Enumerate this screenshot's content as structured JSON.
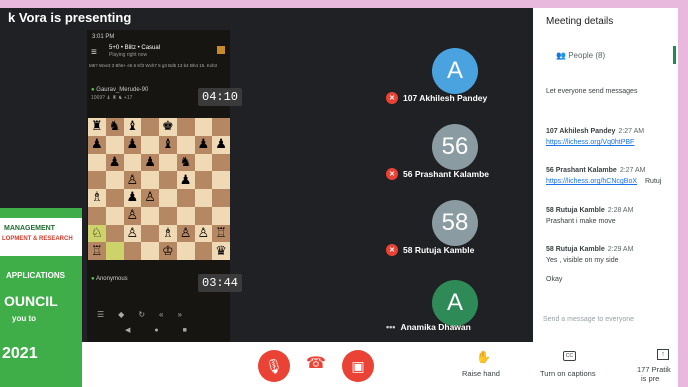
{
  "presenter_banner": "k Vora is presenting",
  "phone": {
    "status_bar": "3:01 PM",
    "game_mode": "5+0 • Blitz • Casual",
    "game_sub": "Playing right now",
    "moves_line": "M6? Wxe3 3 Bh6+ e5 6 Kf3 Wxh7 5 g3 Bd5 13 b4 Bh4 15. Kxh3",
    "opponent_name": "Gaurav_Merude-90",
    "opponent_rating": "1069?",
    "opponent_material": "+17",
    "opponent_clock": "04:10",
    "player_name": "Anonymous",
    "player_clock": "03:44"
  },
  "tiles": [
    {
      "initial": "A",
      "name": "107 Akhilesh Pandey",
      "color": "#4aa3df"
    },
    {
      "initial": "56",
      "name": "56 Prashant Kalambe",
      "color": "#8a9ba1"
    },
    {
      "initial": "58",
      "name": "58 Rutuja Kamble",
      "color": "#8a9ba1"
    },
    {
      "initial": "A",
      "name": "Anamika Dhawan",
      "color": "#2e8b57"
    }
  ],
  "sidebar": {
    "title": "Meeting details",
    "people_tab": "People (8)",
    "info_line": "Let everyone send messages",
    "messages": [
      {
        "name": "107 Akhilesh Pandey",
        "time": "2:27 AM",
        "text": "https://lichess.org/Vq0htPBF",
        "is_link": true
      },
      {
        "name": "56 Prashant Kalambe",
        "time": "2:27 AM",
        "text": "https://lichess.org/hCNcgBoX",
        "extra": "Rutuj",
        "is_link": true
      },
      {
        "name": "58 Rutuja Kamble",
        "time": "2:28 AM",
        "text": "Prashant  i make move",
        "is_link": false
      },
      {
        "name": "58 Rutuja Kamble",
        "time": "2:29 AM",
        "text": "Yes , visible on my side",
        "text2": "Okay",
        "is_link": false
      }
    ],
    "input_placeholder": "Send a message to everyone"
  },
  "bottom": {
    "raise_hand": "Raise hand",
    "captions": "Turn on captions",
    "presenting_line1": "177 Pratik",
    "presenting_line2": "is pre"
  },
  "poster": {
    "line1": "MANAGEMENT",
    "line2": "LOPMENT & RESEARCH",
    "line3": "APPLICATIONS",
    "line4": "OUNCIL",
    "line5": "you to",
    "line6": "2021"
  },
  "board_pieces": [
    [
      "♜",
      "♞",
      "♝",
      "",
      "♚",
      "",
      "",
      ""
    ],
    [
      "♟",
      "",
      "♟",
      "",
      "♝",
      "",
      "♟",
      "♟"
    ],
    [
      "",
      "♟",
      "",
      "♟",
      "",
      "♞",
      "",
      ""
    ],
    [
      "",
      "",
      "♙",
      "",
      "",
      "♟",
      "",
      ""
    ],
    [
      "♗",
      "",
      "♟",
      "♙",
      "",
      "",
      "",
      ""
    ],
    [
      "",
      "",
      "♙",
      "",
      "",
      "",
      "",
      ""
    ],
    [
      "♘",
      "",
      "♙",
      "",
      "♗",
      "♙",
      "♙",
      "♖"
    ],
    [
      "♖",
      "",
      "",
      "",
      "♔",
      "",
      "",
      "♛"
    ]
  ],
  "colors": {
    "end_call": "#ea4335",
    "link": "#1a73e8",
    "poster_green": "#3fae49"
  }
}
